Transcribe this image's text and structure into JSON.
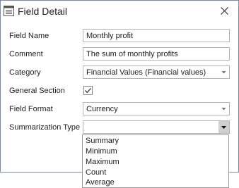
{
  "dialog": {
    "title": "Field Detail",
    "icon": "detail-form-icon",
    "close_icon": "close-icon"
  },
  "form": {
    "field_name": {
      "label": "Field Name",
      "value": "Monthly profit"
    },
    "comment": {
      "label": "Comment",
      "value": "The sum of monthly profits"
    },
    "category": {
      "label": "Category",
      "value": "Financial Values (Financial values)"
    },
    "general_section": {
      "label": "General Section",
      "checked": true
    },
    "field_format": {
      "label": "Field Format",
      "value": "Currency"
    },
    "summarization_type": {
      "label": "Summarization Type",
      "value": ""
    }
  },
  "dropdown": {
    "options": [
      "Summary",
      "Minimum",
      "Maximum",
      "Count",
      "Average"
    ]
  }
}
